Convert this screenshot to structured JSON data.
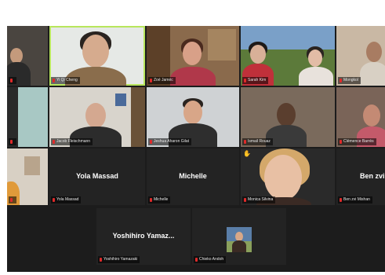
{
  "meeting": {
    "participants": [
      {
        "id": "p0",
        "name": "",
        "has_video": true
      },
      {
        "id": "p1",
        "name": "Yi Qi Cheng",
        "has_video": true,
        "active_speaker": true
      },
      {
        "id": "p2",
        "name": "Zoé Jaméc",
        "has_video": true
      },
      {
        "id": "p3",
        "name": "Sarah Kim",
        "has_video": true
      },
      {
        "id": "p4",
        "name": "Mongkol",
        "has_video": true
      },
      {
        "id": "p5",
        "name": "",
        "has_video": true
      },
      {
        "id": "p6",
        "name": "Jacob Fleischmann",
        "has_video": true
      },
      {
        "id": "p7",
        "name": "Jeshua Aharon Gilat",
        "has_video": true
      },
      {
        "id": "p8",
        "name": "Ismail Rouaz",
        "has_video": true
      },
      {
        "id": "p9",
        "name": "Clémence Barrès",
        "has_video": true
      },
      {
        "id": "p10",
        "name": "",
        "has_video": true
      },
      {
        "id": "p11",
        "name": "Yola Massad",
        "display": "Yola Massad",
        "has_video": false
      },
      {
        "id": "p12",
        "name": "Michelle",
        "display": "Michelle",
        "has_video": false
      },
      {
        "id": "p13",
        "name": "Monica Silvina",
        "has_video": true
      },
      {
        "id": "p14",
        "name": "Ben zvi Mishan",
        "display": "Ben zvi M",
        "has_video": false
      },
      {
        "id": "p15",
        "name": "Yoshihiro Yamazaki",
        "display": "Yoshihiro  Yamaz...",
        "has_video": false
      },
      {
        "id": "p16",
        "name": "Chieko Andoh",
        "has_video": true
      }
    ],
    "reaction_icon": "raised-hand-icon",
    "colors": {
      "active_border": "#b8e65c",
      "muted_mic": "#e02a2a",
      "tile_bg": "#232323"
    }
  }
}
